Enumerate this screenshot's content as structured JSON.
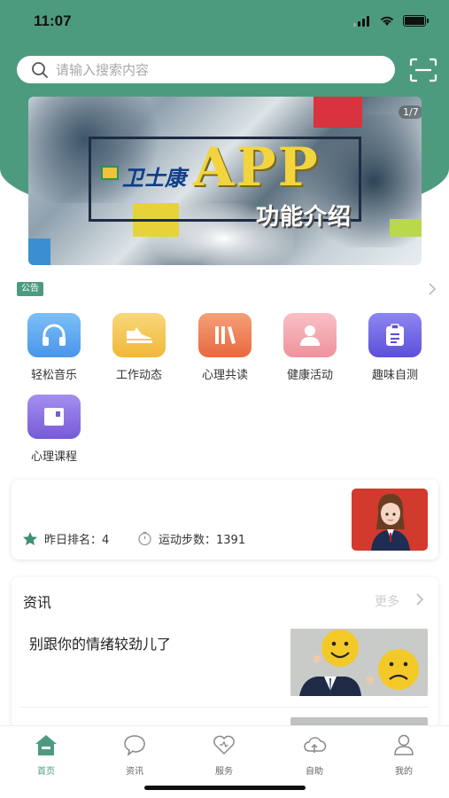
{
  "status_bar": {
    "time": "11:07"
  },
  "search": {
    "placeholder": "请输入搜索内容"
  },
  "banner": {
    "brand": "卫士康",
    "headline": "APP",
    "subtitle": "功能介绍",
    "counter": "1/7"
  },
  "notice": {
    "tag": "公告"
  },
  "features": [
    {
      "label": "轻松音乐",
      "icon": "headphones-icon",
      "color": "#5ba8f0"
    },
    {
      "label": "工作动态",
      "icon": "shoe-icon",
      "color": "#f4c14e"
    },
    {
      "label": "心理共读",
      "icon": "books-icon",
      "color": "#f07a52"
    },
    {
      "label": "健康活动",
      "icon": "person-icon",
      "color": "#f3a0a8"
    },
    {
      "label": "趣味自测",
      "icon": "clipboard-icon",
      "color": "#6f63e6"
    },
    {
      "label": "心理课程",
      "icon": "course-icon",
      "color": "#8a6fe0"
    }
  ],
  "stats": {
    "rank_label": "昨日排名：4",
    "steps_label": "运动步数：1391"
  },
  "news": {
    "title": "资讯",
    "more": "更多",
    "item1_title": "别跟你的情绪较劲儿了"
  },
  "tabs": [
    {
      "label": "首页",
      "icon": "home-icon",
      "active": true
    },
    {
      "label": "资讯",
      "icon": "chat-bubble-icon",
      "active": false
    },
    {
      "label": "服务",
      "icon": "heart-icon",
      "active": false
    },
    {
      "label": "自助",
      "icon": "cloud-upload-icon",
      "active": false
    },
    {
      "label": "我的",
      "icon": "user-icon",
      "active": false
    }
  ],
  "colors": {
    "primary": "#4d9b7f",
    "background": "#ffffff"
  }
}
